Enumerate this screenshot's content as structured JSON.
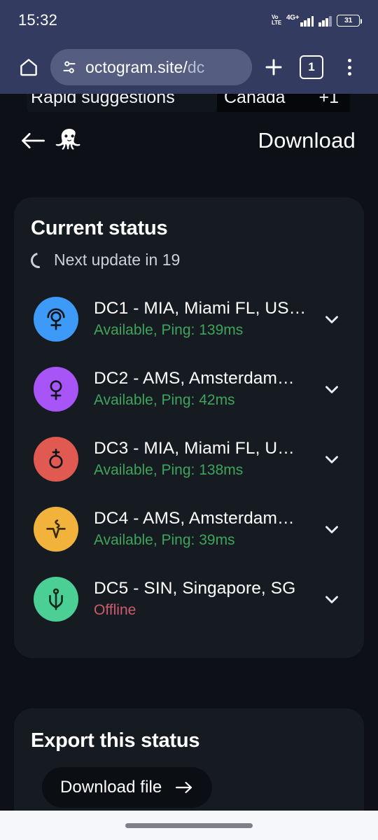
{
  "status_bar": {
    "clock": "15:32",
    "volte_line1": "Vo",
    "volte_line2": "LTE",
    "network_label": "4G+",
    "battery_level": "31"
  },
  "browser": {
    "home_icon": "home-icon",
    "url_visible": "octogram.site/",
    "url_fading": "dc",
    "new_tab_icon": "plus-icon",
    "tab_count": "1",
    "menu_icon": "kebab-menu-icon"
  },
  "peek_strip": {
    "left_text": "Rapid suggestions",
    "middle_text": "Canada",
    "right_text": "+1"
  },
  "app_header": {
    "back_icon": "back-arrow-icon",
    "logo_icon": "octopus-logo-icon",
    "title": "Download"
  },
  "status_card": {
    "title": "Current status",
    "next_update": "Next update in 19",
    "spinner_icon": "loading-spinner-icon",
    "datacenters": [
      {
        "name": "DC1 - MIA, Miami FL, US…",
        "status": "Available, Ping: 139ms",
        "state": "available",
        "color": "#3d9bf7",
        "icon": "pluto-symbol-icon",
        "chevron": "chevron-down-icon"
      },
      {
        "name": "DC2 - AMS, Amsterdam…",
        "status": "Available, Ping: 42ms",
        "state": "available",
        "color": "#a855f7",
        "icon": "venus-symbol-icon",
        "chevron": "chevron-down-icon"
      },
      {
        "name": "DC3 - MIA, Miami FL, U…",
        "status": "Available, Ping: 138ms",
        "state": "available",
        "color": "#e05a52",
        "icon": "earth-symbol-icon",
        "chevron": "chevron-down-icon"
      },
      {
        "name": "DC4 - AMS, Amsterdam…",
        "status": "Available, Ping: 39ms",
        "state": "available",
        "color": "#f2b33d",
        "icon": "aquarius-symbol-icon",
        "chevron": "chevron-down-icon"
      },
      {
        "name": "DC5 - SIN, Singapore, SG",
        "status": "Offline",
        "state": "offline",
        "color": "#4ccf94",
        "icon": "trident-symbol-icon",
        "chevron": "chevron-down-icon"
      }
    ]
  },
  "export_card": {
    "title": "Export this status",
    "download_button": "Download file",
    "download_arrow_icon": "arrow-right-icon"
  },
  "nav_bar": {
    "home_indicator": "home-indicator-pill"
  },
  "colors": {
    "page_background": "#0d1117",
    "card_background": "#161b22",
    "browser_chrome": "#333b60",
    "omnibox": "#555d80",
    "available_green": "#3fa45b",
    "offline_red": "#cf5b6a"
  }
}
